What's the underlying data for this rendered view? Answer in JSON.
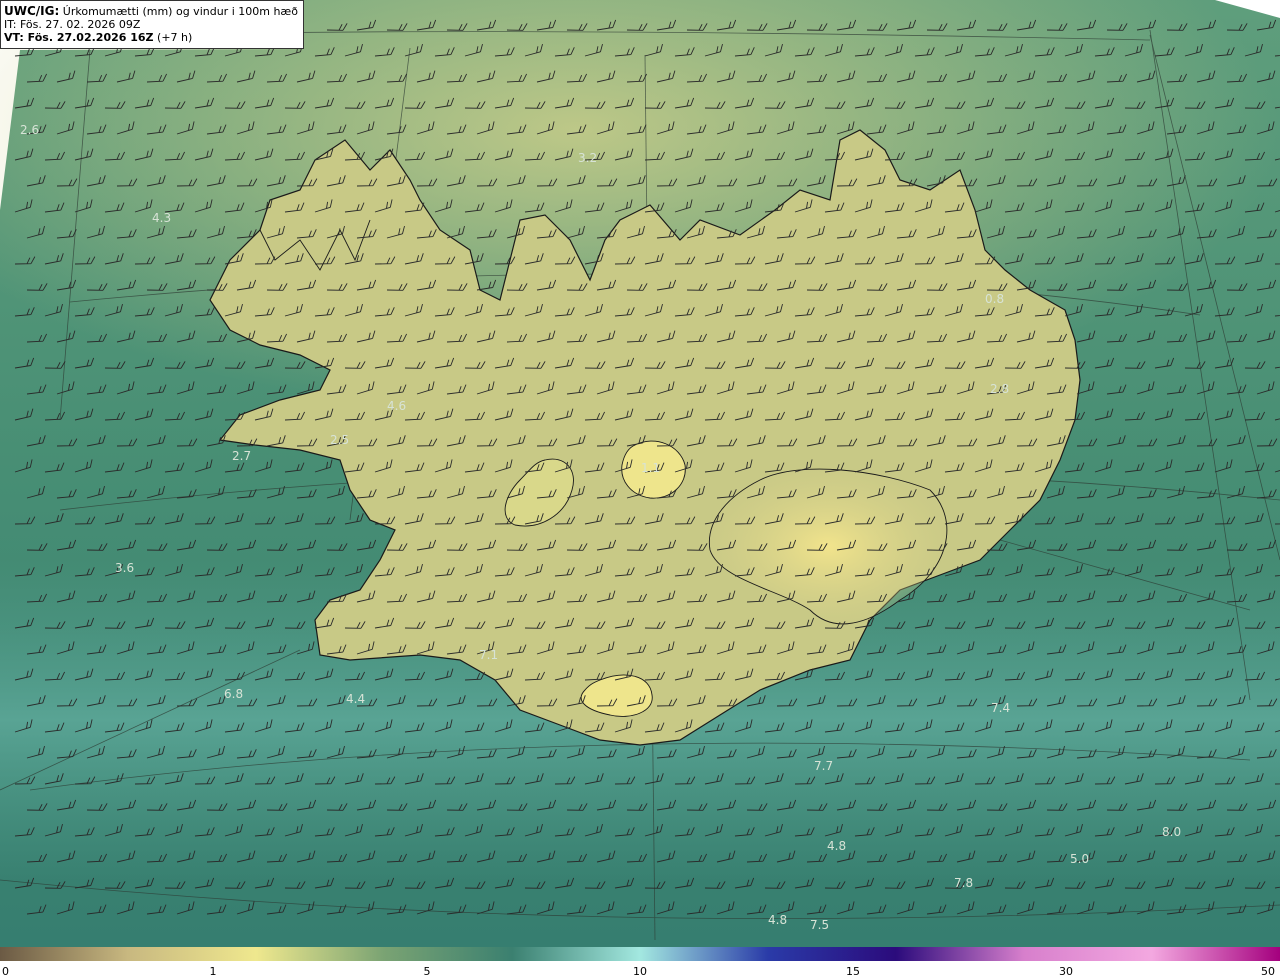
{
  "header": {
    "model": "UWC/IG:",
    "title": "Úrkomumætti (mm) og vindur i 100m hæð",
    "it_line": "IT: Fös. 27. 02. 2026 09Z",
    "vt_label": "VT: Fös. 27.02.2026 16Z",
    "vt_offset": "(+7 h)"
  },
  "colors": {
    "ocean": "#3f8a72",
    "land": "#c9c984",
    "coast": "#1a1a1a",
    "barb": "#2a2a2a"
  },
  "value_labels": [
    {
      "text": "2.6"
    },
    {
      "text": "4.3"
    },
    {
      "text": "3.2"
    },
    {
      "text": "4.6"
    },
    {
      "text": "2.5"
    },
    {
      "text": "2.7"
    },
    {
      "text": "1.1"
    },
    {
      "text": "0.8"
    },
    {
      "text": "2.8"
    },
    {
      "text": "3.6"
    },
    {
      "text": "7.1"
    },
    {
      "text": "6.8"
    },
    {
      "text": "4.4"
    },
    {
      "text": "7.4"
    },
    {
      "text": "7.7"
    },
    {
      "text": "4.8"
    },
    {
      "text": "8.0"
    },
    {
      "text": "5.0"
    },
    {
      "text": "7.8"
    },
    {
      "text": "4.8"
    },
    {
      "text": "7.5"
    }
  ],
  "colorbar": {
    "ticks": [
      "0",
      "1",
      "5",
      "10",
      "15",
      "30",
      "50"
    ],
    "stops": [
      {
        "color": "#6b5a44"
      },
      {
        "color": "#c8b880"
      },
      {
        "color": "#efe88e"
      },
      {
        "color": "#7aa373"
      },
      {
        "color": "#3b8070"
      },
      {
        "color": "#a3e8e0"
      },
      {
        "color": "#2a3ba8"
      },
      {
        "color": "#2b0b7c"
      },
      {
        "color": "#d77fcc"
      },
      {
        "color": "#f3a8e0"
      },
      {
        "color": "#a4007e"
      }
    ]
  }
}
